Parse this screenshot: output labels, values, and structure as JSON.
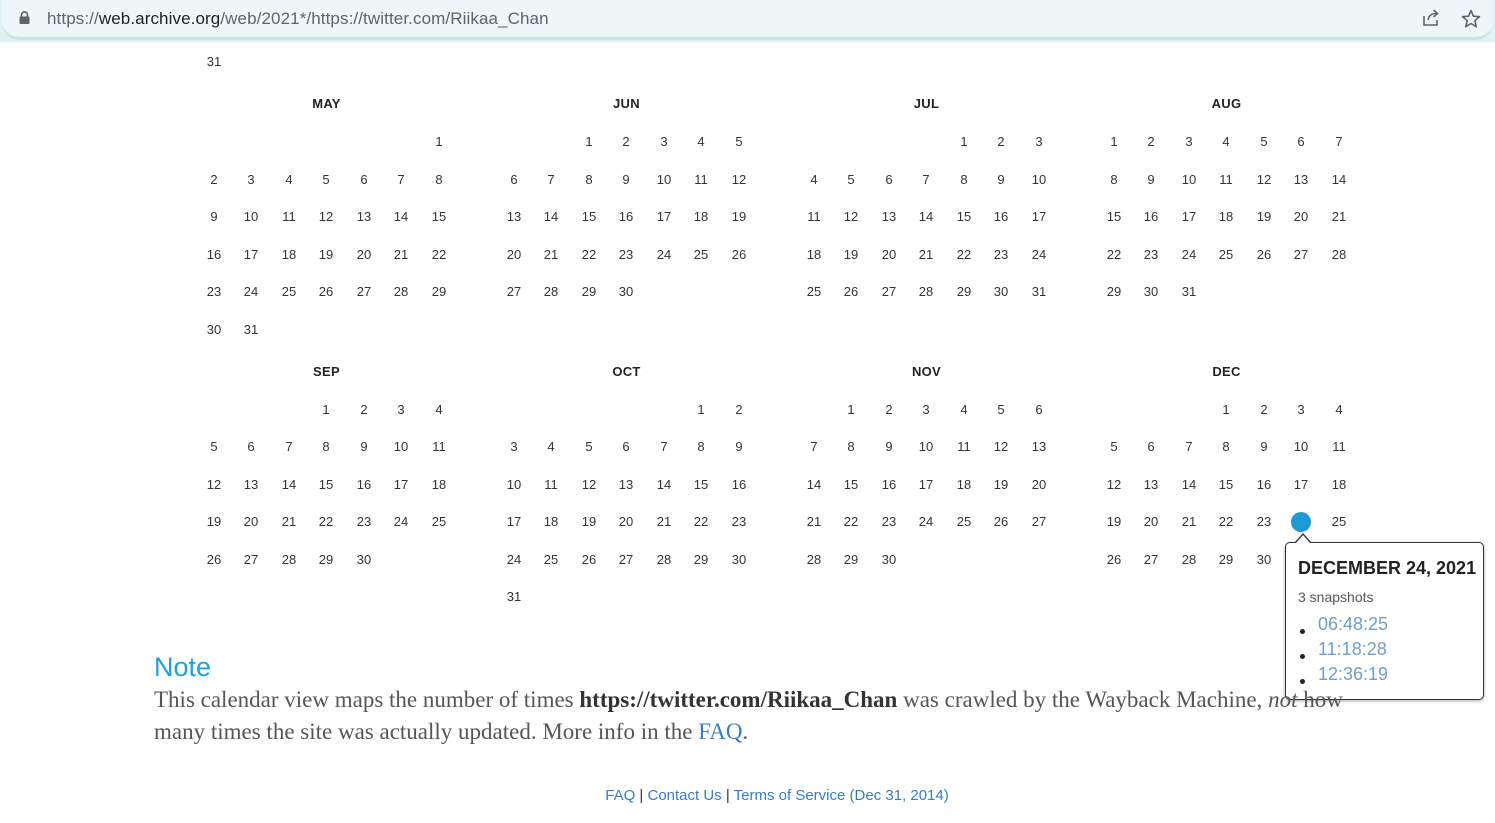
{
  "browser": {
    "url_prefix": "https://",
    "url_domain": "web.archive.org",
    "url_rest": "/web/2021*/https://twitter.com/Riikaa_Chan"
  },
  "calendar": {
    "prev_tail": [
      "31"
    ],
    "months": [
      {
        "name": "MAY",
        "start": 6,
        "days": 31
      },
      {
        "name": "JUN",
        "start": 2,
        "days": 30
      },
      {
        "name": "JUL",
        "start": 4,
        "days": 31
      },
      {
        "name": "AUG",
        "start": 0,
        "days": 31
      },
      {
        "name": "SEP",
        "start": 3,
        "days": 30
      },
      {
        "name": "OCT",
        "start": 5,
        "days": 31
      },
      {
        "name": "NOV",
        "start": 1,
        "days": 30
      },
      {
        "name": "DEC",
        "start": 3,
        "days": 31
      }
    ],
    "highlighted": {
      "month": "DEC",
      "day": "24",
      "color": "#1d9ad6"
    }
  },
  "popup": {
    "title": "DECEMBER 24, 2021",
    "count": "3 snapshots",
    "snapshots": [
      "06:48:25",
      "11:18:28",
      "12:36:19"
    ]
  },
  "note": {
    "heading": "Note",
    "text_1": "This calendar view maps the number of times ",
    "url": "https://twitter.com/Riikaa_Chan",
    "text_2": " was crawled by the Wayback Machine, ",
    "not_word": "not",
    "text_3": " how many times the site was actually updated. More info in the ",
    "faq_link": "FAQ",
    "text_4": "."
  },
  "footer": {
    "faq": "FAQ",
    "sep1": " | ",
    "contact": "Contact Us",
    "sep2": " | ",
    "terms": "Terms of Service (Dec 31, 2014)"
  }
}
